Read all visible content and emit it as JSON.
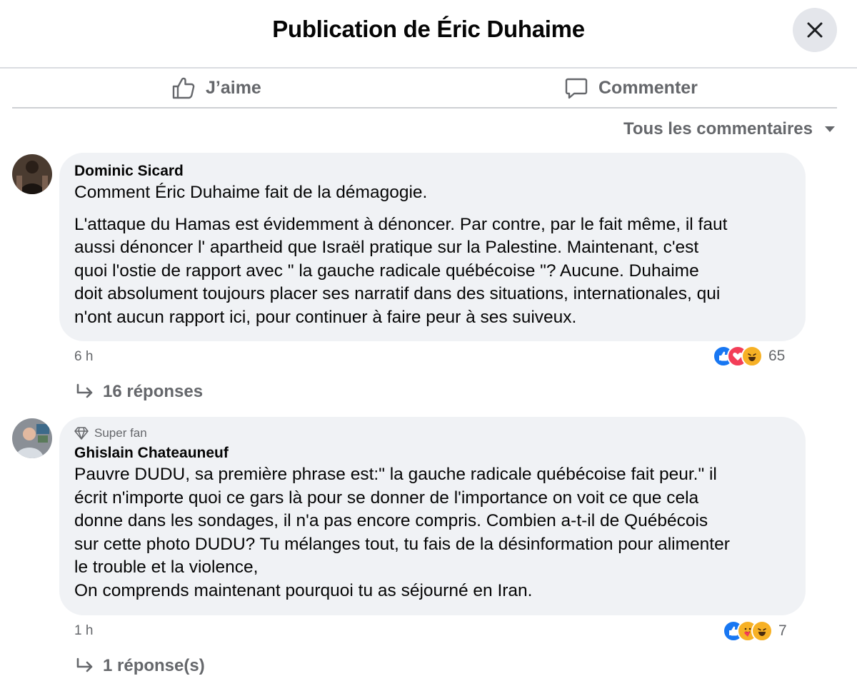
{
  "header": {
    "title": "Publication de Éric Duhaime"
  },
  "actions": {
    "like_label": "J’aime",
    "comment_label": "Commenter"
  },
  "sort": {
    "label": "Tous les commentaires"
  },
  "comments": [
    {
      "author": "Dominic Sicard",
      "text": "Comment Éric Duhaime fait de la démagogie.",
      "text2": "L'attaque du Hamas est évidemment à dénoncer. Par contre, par le fait même, il faut\naussi dénoncer l' apartheid que Israël pratique sur la Palestine. Maintenant, c'est\nquoi l'ostie de rapport avec \" la gauche radicale québécoise \"? Aucune. Duhaime\ndoit absolument toujours placer ses narratif dans des situations, internationales, qui\nn'ont aucun rapport ici, pour continuer à faire peur à ses suiveux.",
      "time": "6 h",
      "reaction_count": "65",
      "reactions": [
        "like",
        "love",
        "haha"
      ],
      "replies": "16 réponses"
    },
    {
      "badge": "Super fan",
      "author": "Ghislain Chateauneuf",
      "text": "Pauvre DUDU, sa première phrase est:\" la gauche radicale québécoise fait peur.\" il\nécrit n'importe quoi ce gars là pour se donner de l'importance on voit ce que cela\ndonne dans les sondages, il n'a pas encore compris. Combien a-t-il de Québécois\nsur cette photo DUDU? Tu mélanges tout, tu fais de la désinformation pour alimenter\nle trouble et la violence,\nOn comprends maintenant pourquoi tu as séjourné en Iran.",
      "time": "1 h",
      "reaction_count": "7",
      "reactions": [
        "like",
        "care",
        "haha"
      ],
      "replies": "1 réponse(s)"
    }
  ],
  "colors": {
    "like": "#1877f2",
    "love": "#f33e58",
    "haha": "#f7b125",
    "muted": "#65676b"
  }
}
